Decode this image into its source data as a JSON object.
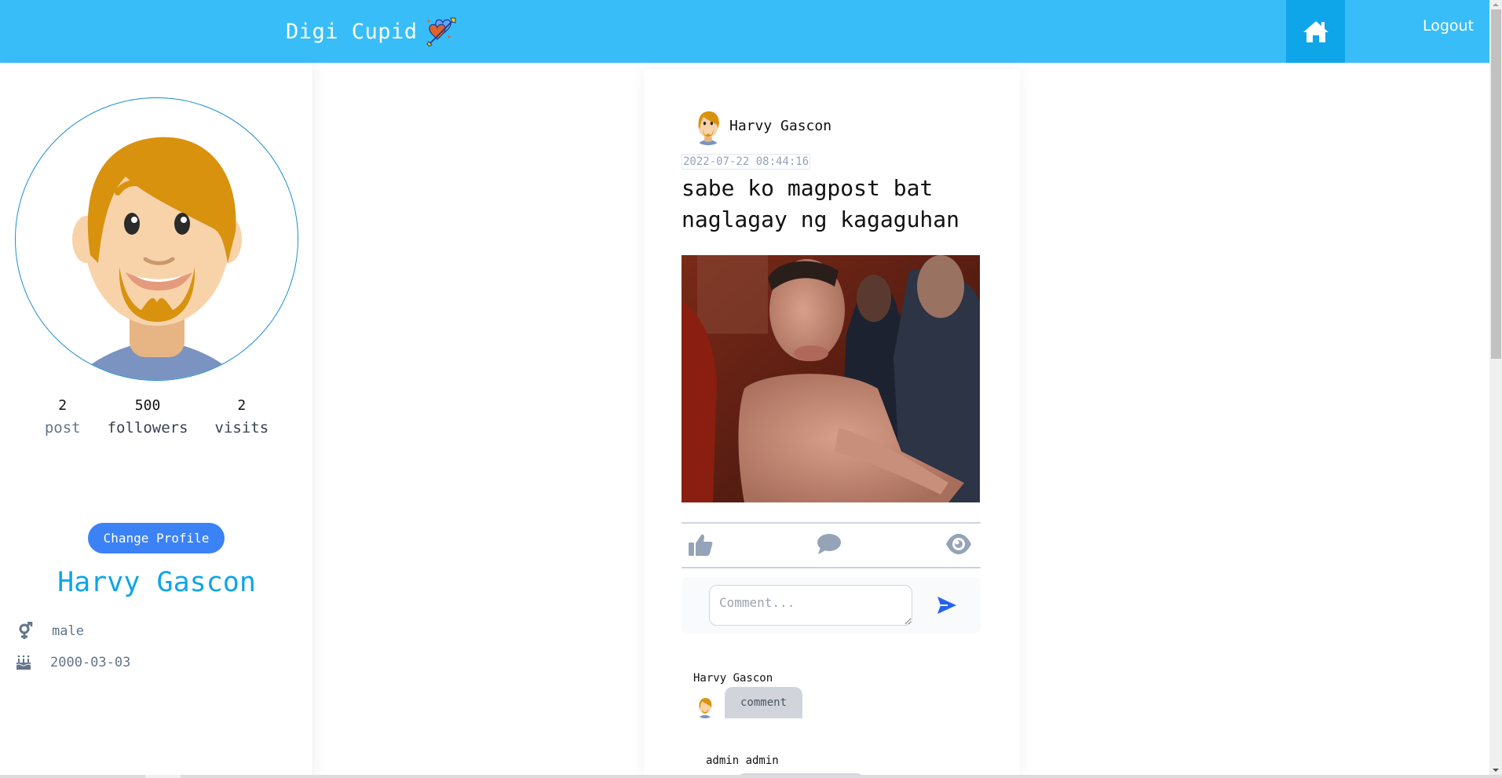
{
  "header": {
    "brand_title": "Digi Cupid",
    "brand_icon": "heart-arrow-icon",
    "home_icon": "home-icon",
    "logout_label": "Logout",
    "bg_color": "#38bdf8",
    "home_bg_color": "#0ea5e9"
  },
  "profile": {
    "avatar": "cartoon-man-avatar",
    "stats": [
      {
        "value": "2",
        "label": "post"
      },
      {
        "value": "500",
        "label": "followers"
      },
      {
        "value": "2",
        "label": "visits"
      }
    ],
    "change_profile_label": "Change Profile",
    "name": "Harvy Gascon",
    "gender_icon": "gender-icon",
    "gender": "male",
    "birthday_icon": "birthday-cake-icon",
    "birthday": "2000-03-03",
    "name_color": "#0ea5e9",
    "button_color": "#3b82f6"
  },
  "post": {
    "author": "Harvy Gascon",
    "timestamp": "2022-07-22 08:44:16",
    "text": "sabe ko magpost bat naglagay ng kagaguhan",
    "image": "photo-shirtless-man-reaching-out",
    "actions": [
      {
        "name": "like",
        "icon": "thumbs-up-icon"
      },
      {
        "name": "comment",
        "icon": "speech-bubble-icon"
      },
      {
        "name": "view",
        "icon": "eye-icon"
      }
    ],
    "comment_placeholder": "Comment...",
    "send_icon": "send-icon",
    "comments": [
      {
        "author": "Harvy Gascon",
        "text": "comment"
      },
      {
        "author": "admin admin",
        "text": ""
      }
    ]
  }
}
